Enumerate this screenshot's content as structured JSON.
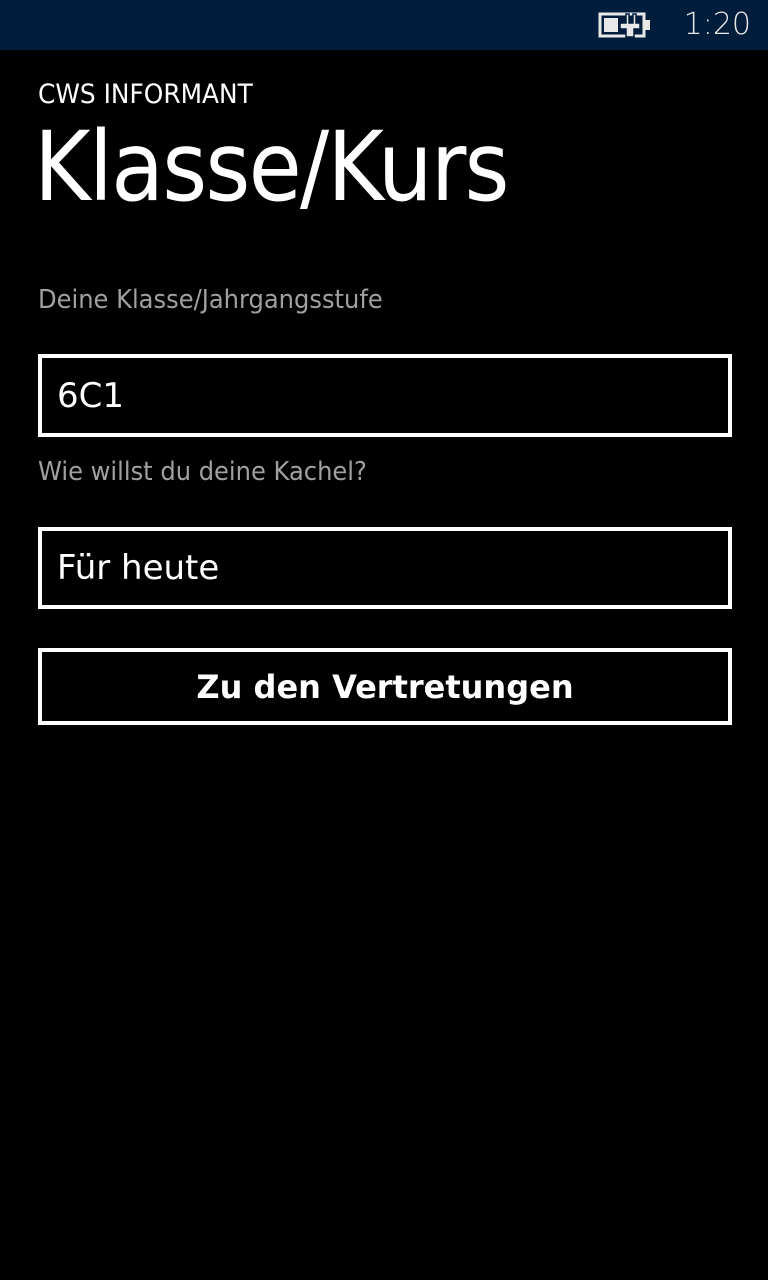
{
  "status_bar": {
    "battery_icon": "battery-charging-icon",
    "time": "1:20",
    "background": "#001e3c"
  },
  "header": {
    "app_title": "CWS INFORMANT",
    "page_title": "Klasse/Kurs"
  },
  "form": {
    "class_label": "Deine Klasse/Jahrgangsstufe",
    "class_value": "6C1",
    "tile_label": "Wie willst du deine Kachel?",
    "tile_value": "Für heute",
    "submit_label": "Zu den Vertretungen"
  },
  "colors": {
    "background": "#000000",
    "foreground": "#ffffff",
    "label": "#a0a0a0"
  }
}
